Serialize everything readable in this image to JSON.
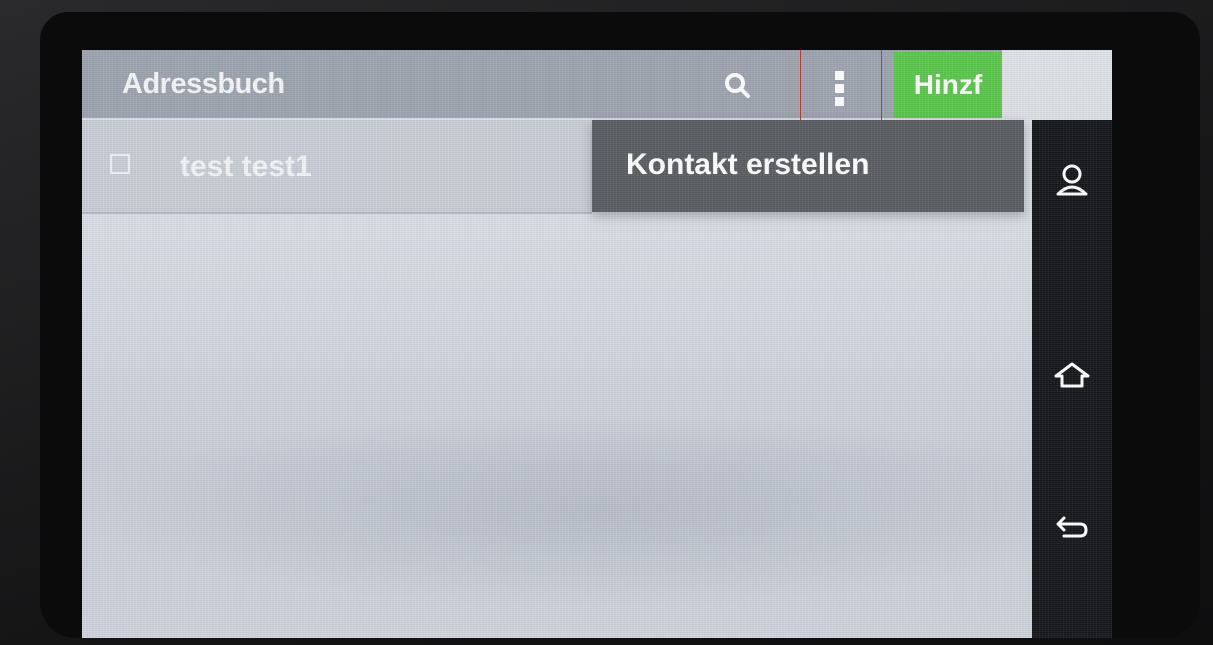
{
  "action_bar": {
    "title": "Adressbuch",
    "search_icon": "search-icon",
    "overflow_icon": "more-vert-icon",
    "add_label": "Hinzf"
  },
  "contacts": [
    {
      "name": "test test1",
      "checked": false
    }
  ],
  "overflow_menu": {
    "items": [
      {
        "label": "Kontakt erstellen"
      }
    ]
  },
  "nav_bar": {
    "buttons": [
      {
        "icon": "person-icon"
      },
      {
        "icon": "home-icon"
      },
      {
        "icon": "back-icon"
      }
    ]
  },
  "colors": {
    "add_button": "#58c84a",
    "highlight_box": "#c0392b",
    "menu_background": "#5a5d62"
  }
}
